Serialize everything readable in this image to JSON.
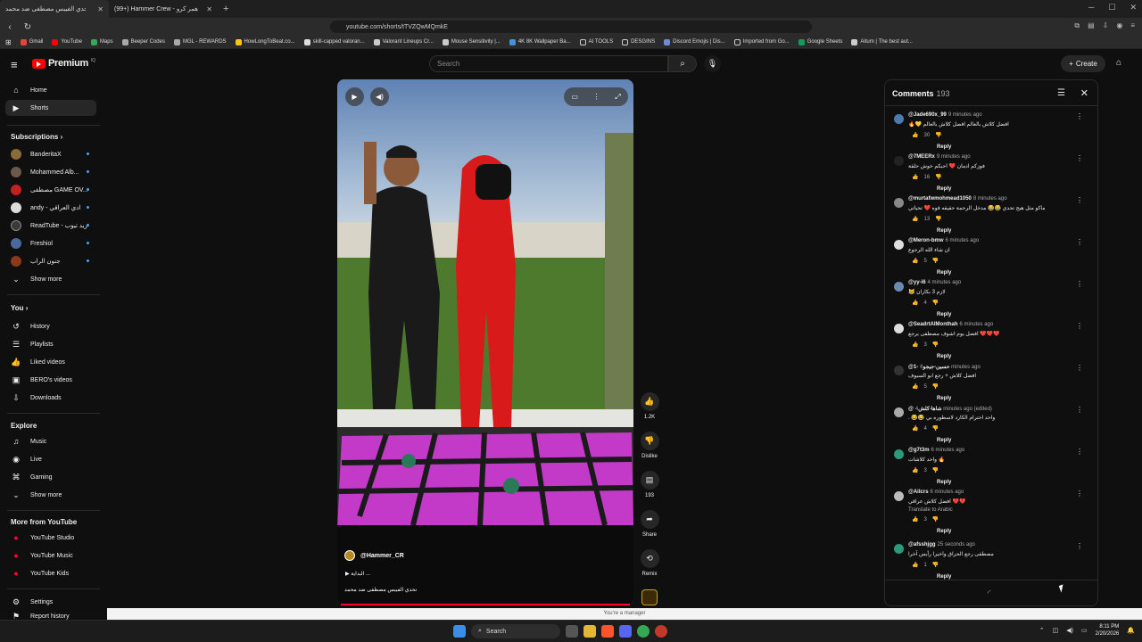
{
  "browser": {
    "tabs": [
      {
        "title": "تحدي الفيبس مصطفى ضد محمد",
        "active": true
      },
      {
        "title": "(99+) Hammer Crew - همر كرو (@ham...",
        "active": false
      }
    ],
    "url": "youtube.com/shorts/tTVZQwMQmkE",
    "bookmarks": [
      "Gmail",
      "YouTube",
      "Maps",
      "Beeper Codes",
      "MGL - REWARDS",
      "HowLongToBeat.co...",
      "skill-capped valoran...",
      "Valorant Lineups Cr...",
      "Mouse Sensitivity |...",
      "4K 8K Wallpaper Ba...",
      "AI TOOLS",
      "DESGINS",
      "Discord Emojis | Dis...",
      "Imported from Go...",
      "Google Sheets",
      "Aitum | The best aut..."
    ]
  },
  "header": {
    "logo_text": "Premium",
    "logo_sup": "IQ",
    "search_placeholder": "Search",
    "create_label": "Create"
  },
  "sidebar": {
    "main": [
      {
        "label": "Home",
        "icon": "home-icon"
      },
      {
        "label": "Shorts",
        "icon": "shorts-icon",
        "active": true
      }
    ],
    "subscriptions_title": "Subscriptions",
    "subscriptions": [
      {
        "label": "BanderitaX",
        "color": "#8a6a3a"
      },
      {
        "label": "Mohammed Alb...",
        "color": "#6b5a4a"
      },
      {
        "label": "مصطفى GAME OV...",
        "color": "#c42020"
      },
      {
        "label": "andy - ادي العراقي",
        "color": "#dddddd"
      },
      {
        "label": "ReadTube - ريد تيوب",
        "color": "#3a3a3a"
      },
      {
        "label": "Freshiol",
        "color": "#4a6a9a"
      },
      {
        "label": "جنون الراب",
        "color": "#8a3a1a"
      }
    ],
    "show_more": "Show more",
    "you_title": "You",
    "you_items": [
      {
        "label": "History",
        "icon": "history-icon"
      },
      {
        "label": "Playlists",
        "icon": "playlists-icon"
      },
      {
        "label": "Liked videos",
        "icon": "like-icon"
      },
      {
        "label": "BERO's videos",
        "icon": "videos-icon"
      },
      {
        "label": "Downloads",
        "icon": "download-icon"
      }
    ],
    "explore_title": "Explore",
    "explore_items": [
      {
        "label": "Music",
        "icon": "music-icon"
      },
      {
        "label": "Live",
        "icon": "live-icon"
      },
      {
        "label": "Gaming",
        "icon": "gaming-icon"
      },
      {
        "label": "Show more",
        "icon": "chevron-down-icon"
      }
    ],
    "more_title": "More from YouTube",
    "more_items": [
      {
        "label": "YouTube Studio"
      },
      {
        "label": "YouTube Music"
      },
      {
        "label": "YouTube Kids"
      }
    ],
    "settings": "Settings",
    "report": "Report history"
  },
  "video": {
    "channel": "@Hammer_CR",
    "audio": "البداية",
    "title": "تحدي الفيبس مصطفى ضد محمد",
    "progress": 1.0
  },
  "actions": {
    "likes": "1.2K",
    "dislike": "Dislike",
    "comments": "193",
    "share": "Share",
    "remix": "Remix"
  },
  "comments_panel": {
    "title": "Comments",
    "count": "193",
    "items": [
      {
        "handle": "@Jade690x_99",
        "time": "9 minutes ago",
        "text": "افضل كلاش بالعالم افضل كلاش بالعالم 💛🔥",
        "likes": "30",
        "color": "#4a7ab0"
      },
      {
        "handle": "@7MEERx",
        "time": "9 minutes ago",
        "text": "فوزكم ادمان ❤️ احبكم خوش حلقة",
        "likes": "16",
        "color": "#222222"
      },
      {
        "handle": "@murtafwmohmead1050",
        "time": "8 minutes ago",
        "text": "ماكو مثل هيج تحدي 😂😂 مدخل الرحمة حقيقه قوه ❤️ تحياتي",
        "likes": "13",
        "color": "#888888"
      },
      {
        "handle": "@Meron-bmw",
        "time": "6 minutes ago",
        "text": "ان شاء الله الرجوع",
        "likes": "5",
        "color": "#dddddd"
      },
      {
        "handle": "@yy-i6",
        "time": "4 minutes ago",
        "text": "لازم 3 بكاران 😹",
        "likes": "4",
        "color": "#6a8ab0"
      },
      {
        "handle": "@SeadrtAlMonthah",
        "time": "6 minutes ago",
        "text": "❤️❤️❤️ افضل يوم اشوف مصطفى يرجع",
        "likes": "3",
        "color": "#dddddd"
      },
      {
        "handle": "@1-حسين-جيجو",
        "time": "6 minutes ago",
        "text": "افضل كلاش + رجع ابو السيوف",
        "likes": "5",
        "color": "#333333"
      },
      {
        "handle": "@شاها-كلش",
        "time": "4 minutes ago (edited)",
        "text": "واحد احترام الكارد لاسطوره بي 😂😂 .",
        "likes": "4",
        "color": "#aaaaaa"
      },
      {
        "handle": "@g7t3m",
        "time": "6 minutes ago",
        "text": "🔥 واحد كلاشات",
        "likes": "3",
        "color": "#2a9a7a"
      },
      {
        "handle": "@Ailcrs",
        "time": "6 minutes ago",
        "text": "❤️❤️ افضل كلاش عراقي",
        "translate": "Translate to Arabic",
        "likes": "3",
        "color": "#bbbbbb"
      },
      {
        "handle": "@afsshjgg",
        "time": "25 seconds ago",
        "text": "مصطفى رجع الحراق واخيرا رأيس آخرا",
        "likes": "1",
        "color": "#2a9a7a"
      }
    ],
    "reply_label": "Reply"
  },
  "status_text": "You're a manager",
  "taskbar": {
    "search": "Search",
    "time": "8:11 PM",
    "date": "2/20/2026"
  }
}
